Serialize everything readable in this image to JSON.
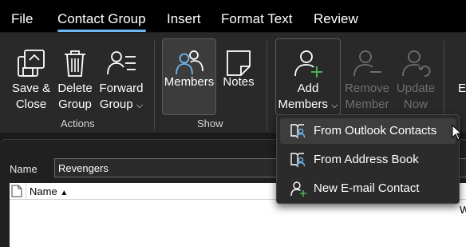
{
  "tabs": [
    {
      "label": "File"
    },
    {
      "label": "Contact Group",
      "active": true
    },
    {
      "label": "Insert"
    },
    {
      "label": "Format Text"
    },
    {
      "label": "Review"
    }
  ],
  "ribbon": {
    "actions": {
      "group_label": "Actions",
      "save_close": {
        "line1": "Save &",
        "line2": "Close"
      },
      "delete_group": {
        "line1": "Delete",
        "line2": "Group"
      },
      "forward_group": {
        "line1": "Forward",
        "line2": "Group"
      }
    },
    "show": {
      "group_label": "Show",
      "members": "Members",
      "notes": "Notes"
    },
    "members_group": {
      "add_members": {
        "line1": "Add",
        "line2": "Members"
      },
      "remove_member": {
        "line1": "Remove",
        "line2": "Member"
      },
      "update_now": {
        "line1": "Update",
        "line2": "Now"
      },
      "partial_label": "E"
    }
  },
  "form": {
    "name_label": "Name",
    "name_value": "Revengers",
    "column_name": "Name",
    "partial_right": "W"
  },
  "add_members_menu": {
    "items": [
      {
        "label": "From Outlook Contacts",
        "highlighted": true
      },
      {
        "label": "From Address Book"
      },
      {
        "label": "New E-mail Contact"
      }
    ]
  },
  "colors": {
    "accent": "#6cb8f6",
    "add_green": "#4caf50",
    "ribbon_bg": "#292929",
    "disabled_text": "#6f6f6f"
  }
}
